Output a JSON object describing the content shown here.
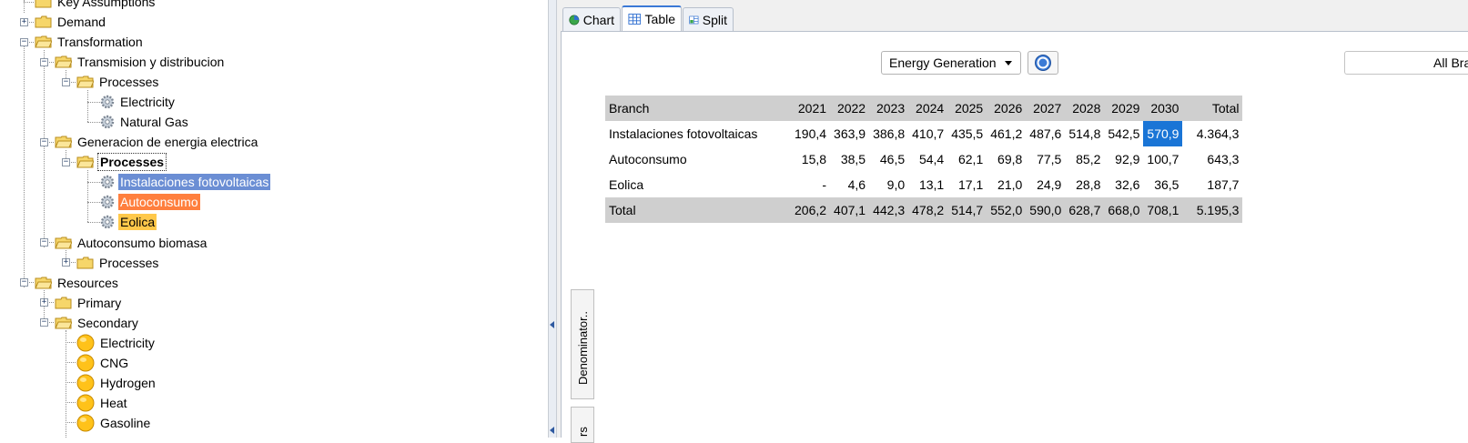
{
  "tree": {
    "items": [
      {
        "label": "Key Assumptions",
        "icon": "folder-icon"
      },
      {
        "label": "Demand",
        "icon": "folder-icon"
      },
      {
        "label": "Transformation",
        "icon": "folder-icon"
      },
      {
        "label": "Transmision y distribucion",
        "icon": "folder-icon"
      },
      {
        "label": "Processes",
        "icon": "folder-icon"
      },
      {
        "label": "Electricity",
        "icon": "gear-icon"
      },
      {
        "label": "Natural Gas",
        "icon": "gear-icon"
      },
      {
        "label": "Generacion de energia electrica",
        "icon": "folder-icon"
      },
      {
        "label": "Processes",
        "icon": "folder-icon"
      },
      {
        "label": "Instalaciones fotovoltaicas",
        "icon": "gear-icon",
        "highlight": "#6b8ed4"
      },
      {
        "label": "Autoconsumo",
        "icon": "gear-icon",
        "highlight": "#ff7f3e"
      },
      {
        "label": "Eolica",
        "icon": "gear-icon",
        "highlight": "#ffc84a"
      },
      {
        "label": "Autoconsumo biomasa",
        "icon": "folder-icon"
      },
      {
        "label": "Processes",
        "icon": "folder-icon"
      },
      {
        "label": "Resources",
        "icon": "folder-icon"
      },
      {
        "label": "Primary",
        "icon": "folder-icon"
      },
      {
        "label": "Secondary",
        "icon": "folder-icon"
      },
      {
        "label": "Electricity",
        "icon": "ball-icon"
      },
      {
        "label": "CNG",
        "icon": "ball-icon"
      },
      {
        "label": "Hydrogen",
        "icon": "ball-icon"
      },
      {
        "label": "Heat",
        "icon": "ball-icon"
      },
      {
        "label": "Gasoline",
        "icon": "ball-icon"
      }
    ]
  },
  "tabs": [
    {
      "label": "Chart",
      "icon": "chart-icon"
    },
    {
      "label": "Table",
      "icon": "table-icon",
      "active": true
    },
    {
      "label": "Split",
      "icon": "split-icon"
    }
  ],
  "toolbar": {
    "variable": "Energy Generation",
    "help_icon": "help-icon",
    "branches": "All Bra"
  },
  "table": {
    "headers": [
      "Branch",
      "2021",
      "2022",
      "2023",
      "2024",
      "2025",
      "2026",
      "2027",
      "2028",
      "2029",
      "2030",
      "Total"
    ],
    "rows": [
      [
        "Instalaciones fotovoltaicas",
        "190,4",
        "363,9",
        "386,8",
        "410,7",
        "435,5",
        "461,2",
        "487,6",
        "514,8",
        "542,5",
        "570,9",
        "4.364,3"
      ],
      [
        "Autoconsumo",
        "15,8",
        "38,5",
        "46,5",
        "54,4",
        "62,1",
        "69,8",
        "77,5",
        "85,2",
        "92,9",
        "100,7",
        "643,3"
      ],
      [
        "Eolica",
        "-",
        "4,6",
        "9,0",
        "13,1",
        "17,1",
        "21,0",
        "24,9",
        "28,8",
        "32,6",
        "36,5",
        "187,7"
      ]
    ],
    "total": [
      "Total",
      "206,2",
      "407,1",
      "442,3",
      "478,2",
      "514,7",
      "552,0",
      "590,0",
      "628,7",
      "668,0",
      "708,1",
      "5.195,3"
    ],
    "selection_color": "#1a75d6"
  },
  "side_tabs": {
    "denominator": "Denominator..",
    "second": "rs"
  }
}
